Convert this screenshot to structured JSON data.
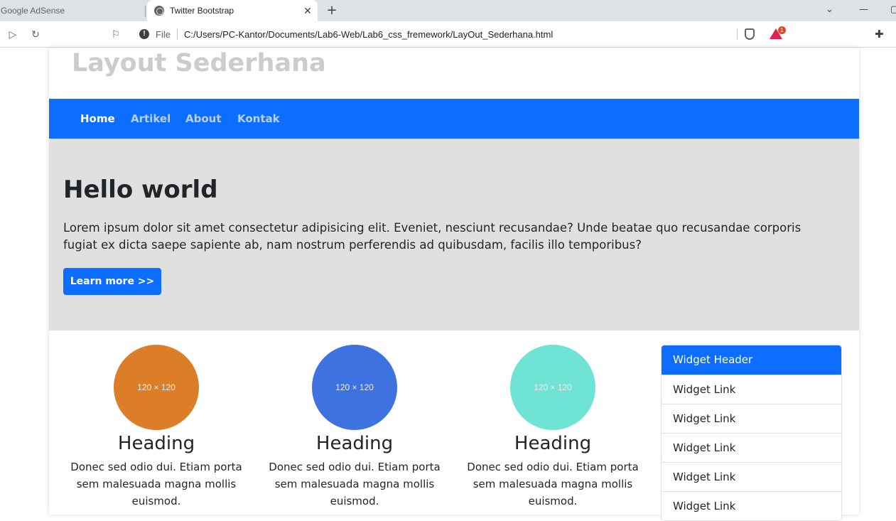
{
  "browser": {
    "tabs": [
      {
        "label": "Google AdSense",
        "active": false
      },
      {
        "label": "Twitter Bootstrap",
        "active": true
      }
    ],
    "address": {
      "scheme_label": "File",
      "url": "C:/Users/PC-Kantor/Documents/Lab6-Web/Lab6_css_fremework/LayOut_Sederhana.html"
    },
    "rewards_badge": "1"
  },
  "site": {
    "title": "Layout Sederhana",
    "nav": [
      {
        "label": "Home",
        "active": true
      },
      {
        "label": "Artikel",
        "active": false
      },
      {
        "label": "About",
        "active": false
      },
      {
        "label": "Kontak",
        "active": false
      }
    ]
  },
  "jumbotron": {
    "heading": "Hello world",
    "text": "Lorem ipsum dolor sit amet consectetur adipisicing elit. Eveniet, nesciunt recusandae? Unde beatae quo recusandae corporis fugiat ex dicta saepe sapiente ab, nam nostrum perferendis ad quibusdam, facilis illo temporibus?",
    "button_label": "Learn more >>"
  },
  "features": [
    {
      "placeholder": "120 × 120",
      "color": "#db7e27",
      "heading": "Heading",
      "text": "Donec sed odio dui. Etiam porta sem malesuada magna mollis euismod."
    },
    {
      "placeholder": "120 × 120",
      "color": "#3f72e1",
      "heading": "Heading",
      "text": "Donec sed odio dui. Etiam porta sem malesuada magna mollis euismod."
    },
    {
      "placeholder": "120 × 120",
      "color": "#6fe3d4",
      "heading": "Heading",
      "text": "Donec sed odio dui. Etiam porta sem malesuada magna mollis euismod."
    }
  ],
  "widget": {
    "header": "Widget Header",
    "links": [
      "Widget Link",
      "Widget Link",
      "Widget Link",
      "Widget Link",
      "Widget Link"
    ]
  },
  "colors": {
    "primary": "#0d6efd",
    "jumbotron_bg": "#e0e0e0",
    "title": "#cccccc"
  }
}
